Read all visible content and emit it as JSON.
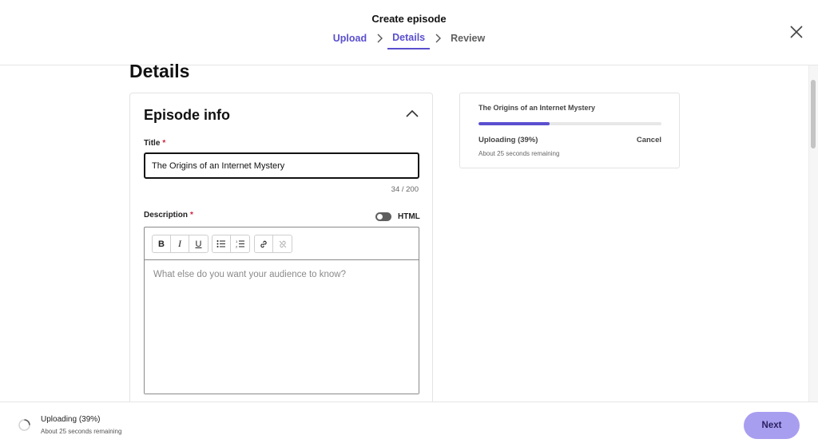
{
  "header": {
    "title": "Create episode",
    "steps": [
      {
        "label": "Upload",
        "state": "done"
      },
      {
        "label": "Details",
        "state": "active"
      },
      {
        "label": "Review",
        "state": "upcoming"
      }
    ],
    "close_icon": "close-icon"
  },
  "page": {
    "heading": "Details"
  },
  "episode_info": {
    "title": "Episode info",
    "collapse_icon": "chevron-up-icon",
    "title_field": {
      "label": "Title",
      "required_mark": "*",
      "value": "The Origins of an Internet Mystery",
      "counter": "34 / 200"
    },
    "description_field": {
      "label": "Description",
      "required_mark": "*",
      "html_toggle_label": "HTML",
      "html_toggle_on": false,
      "placeholder": "What else do you want your audience to know?",
      "toolbar": {
        "bold": "B",
        "italic": "I",
        "underline": "U",
        "bullet_list_icon": "bullet-list-icon",
        "numbered_list_icon": "numbered-list-icon",
        "link_icon": "link-icon",
        "unlink_icon": "unlink-icon"
      }
    }
  },
  "upload_card": {
    "file_name": "The Origins of an Internet Mystery",
    "progress_percent": 39,
    "status": "Uploading (39%)",
    "cancel_label": "Cancel",
    "remaining": "About 25 seconds remaining"
  },
  "footer": {
    "status": "Uploading (39%)",
    "remaining": "About 25 seconds remaining",
    "next_label": "Next"
  },
  "colors": {
    "accent": "#5a4fcf",
    "next_button": "#a89ef0",
    "required": "#d0203a"
  }
}
